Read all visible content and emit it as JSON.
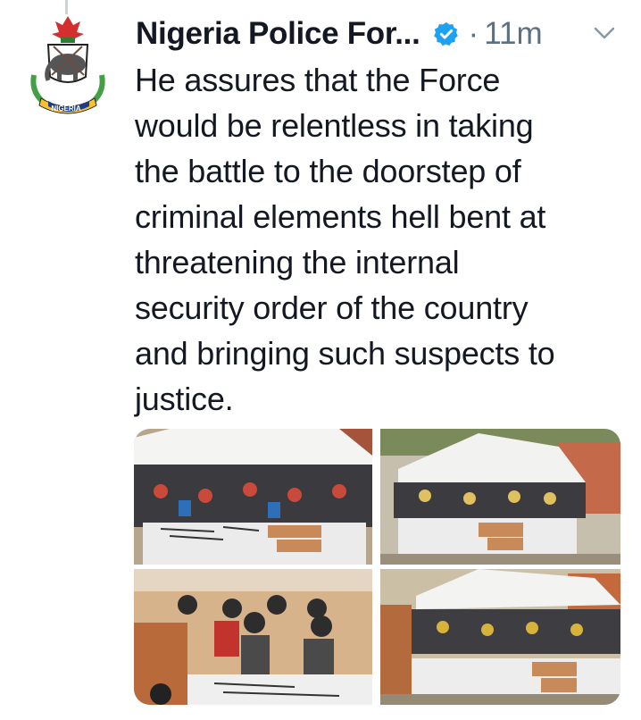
{
  "tweet": {
    "author_name": "Nigeria Police For...",
    "separator": "·",
    "timestamp": "11m",
    "text": "He assures that the Force\nwould be relentless in taking\nthe battle to the doorstep of\ncriminal elements hell bent at\nthreatening the internal\nsecurity order of the country\nand bringing such suspects to\njustice."
  },
  "avatar": {
    "logo_text": "NIGERIA"
  },
  "icons": {
    "verified": "verified-badge-icon",
    "more": "chevron-down-icon"
  },
  "colors": {
    "verified_blue": "#1da1f2",
    "meta_gray": "#5b7083",
    "text": "#141823"
  },
  "media": {
    "photo_count": 4
  }
}
